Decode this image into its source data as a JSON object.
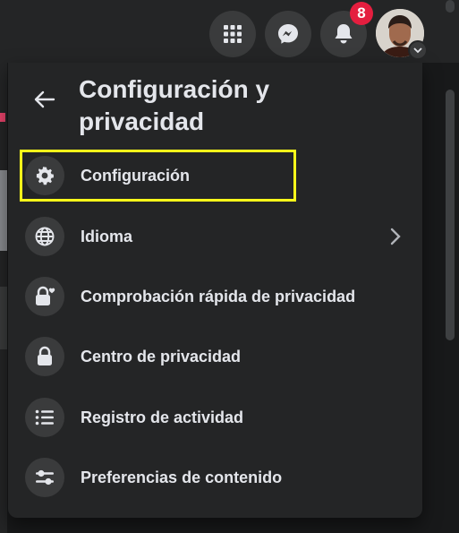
{
  "header": {
    "notification_count": "8",
    "icons": [
      "menu-grid-icon",
      "messenger-icon",
      "bell-icon"
    ]
  },
  "panel": {
    "title": "Configuración y privacidad",
    "items": [
      {
        "label": "Configuración",
        "icon": "gear-icon",
        "highlighted": true
      },
      {
        "label": "Idioma",
        "icon": "globe-icon",
        "has_submenu": true
      },
      {
        "label": "Comprobación rápida de privacidad",
        "icon": "lock-heart-icon"
      },
      {
        "label": "Centro de privacidad",
        "icon": "lock-icon"
      },
      {
        "label": "Registro de actividad",
        "icon": "list-icon"
      },
      {
        "label": "Preferencias de contenido",
        "icon": "sliders-icon"
      }
    ]
  },
  "colors": {
    "panel_bg": "#242526",
    "icon_bg": "#3a3b3c",
    "badge": "#e41e3f",
    "highlight_box": "#ffff1a",
    "text": "#e4e6eb"
  }
}
